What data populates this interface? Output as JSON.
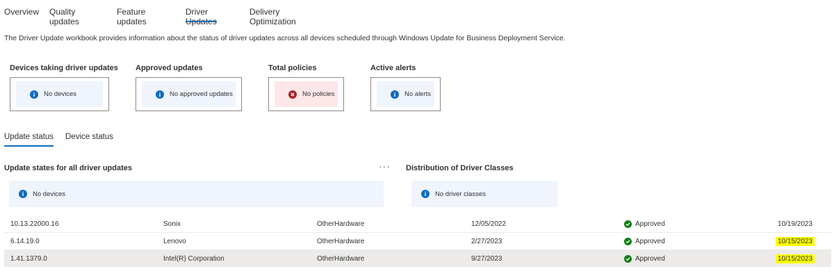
{
  "tabs": [
    "Overview",
    "Quality updates",
    "Feature updates",
    "Driver Updates",
    "Delivery Optimization"
  ],
  "active_tab": "Driver Updates",
  "description": "The Driver Update workbook provides information about the status of driver updates across all devices scheduled through Windows Update for Business Deployment Service.",
  "tiles": [
    {
      "title": "Devices taking driver updates",
      "message": "No devices",
      "state": "info"
    },
    {
      "title": "Approved updates",
      "message": "No approved updates",
      "state": "info"
    },
    {
      "title": "Total policies",
      "message": "No policies",
      "state": "error"
    },
    {
      "title": "Active alerts",
      "message": "No alerts",
      "state": "info"
    }
  ],
  "subtabs": [
    "Update status",
    "Device status"
  ],
  "active_subtab": "Update status",
  "sections": {
    "left": {
      "title": "Update states for all driver updates",
      "message": "No devices",
      "more_icon": "ellipsis-icon"
    },
    "right": {
      "title": "Distribution of Driver Classes",
      "message": "No driver classes"
    }
  },
  "rows": [
    {
      "version": "10.13.22000.16",
      "manufacturer": "Sonix",
      "class": "OtherHardware",
      "date": "12/05/2022",
      "status": "Approved",
      "updated": "10/19/2023"
    },
    {
      "version": "6.14.19.0",
      "manufacturer": "Lenovo",
      "class": "OtherHardware",
      "date": "2/27/2023",
      "status": "Approved",
      "updated": "10/15/2023"
    },
    {
      "version": "1.41.1379.0",
      "manufacturer": "Intel(R) Corporation",
      "class": "OtherHardware",
      "date": "9/27/2023",
      "status": "Approved",
      "updated": "10/15/2023"
    }
  ],
  "colors": {
    "accent": "#0f6cbd",
    "info_bg": "#eff4fd",
    "error_bg": "#fde7e9",
    "error": "#a4262c",
    "success": "#107c10",
    "highlight": "#ffff00"
  }
}
